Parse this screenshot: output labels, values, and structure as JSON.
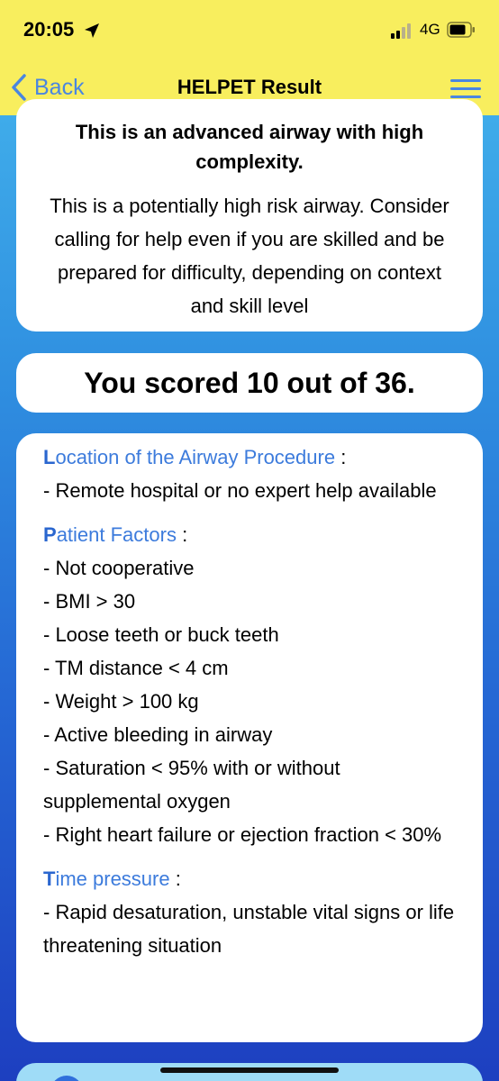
{
  "status_bar": {
    "time": "20:05",
    "network": "4G"
  },
  "nav": {
    "back_label": "Back",
    "title": "HELPET Result"
  },
  "risk_card": {
    "heading": "This is an advanced airway with high complexity.",
    "text": "This is a potentially high risk airway. Consider calling for help even if you are skilled and be prepared for difficulty, depending on context and skill level"
  },
  "score": {
    "text": "You scored 10 out of 36."
  },
  "factors": {
    "location": {
      "initial": "L",
      "rest": "ocation of the Airway Procedure",
      "colon": " :",
      "items": [
        "- Remote hospital or no expert help available"
      ]
    },
    "patient": {
      "initial": "P",
      "rest": "atient Factors",
      "colon": " :",
      "items": [
        "- Not cooperative",
        "- BMI > 30",
        "- Loose teeth or buck teeth",
        "- TM distance < 4 cm",
        "- Weight > 100 kg",
        "- Active bleeding in airway",
        "- Saturation < 95% with or without supplemental oxygen",
        "- Right heart failure or ejection fraction < 30%"
      ]
    },
    "time": {
      "initial": "T",
      "rest": "ime pressure",
      "colon": " :",
      "items": [
        "- Rapid desaturation, unstable vital signs or life threatening situation"
      ]
    }
  },
  "colors": {
    "header_bg": "#f8ee5e",
    "accent_blue": "#4a86e0",
    "section_blue": "#3c7bdc"
  }
}
